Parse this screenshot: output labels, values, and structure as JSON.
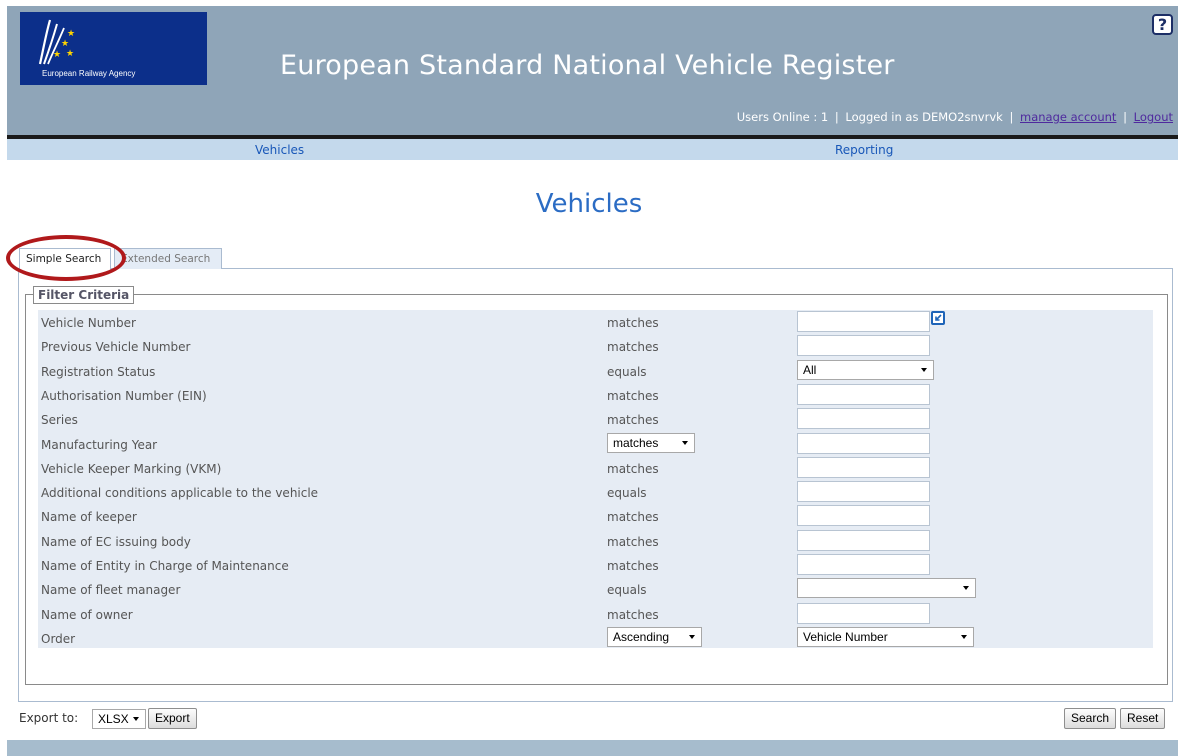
{
  "header": {
    "logo_text": "European Railway Agency",
    "app_title": "European Standard National Vehicle Register",
    "help_label": "?",
    "users_online": "Users Online : 1",
    "logged_in_as": "Logged in as DEMO2snvrvk",
    "manage_account": "manage account",
    "logout": "Logout",
    "separator": "|"
  },
  "nav": {
    "vehicles": "Vehicles",
    "reporting": "Reporting"
  },
  "page": {
    "title": "Vehicles",
    "tabs": [
      {
        "label": "Simple Search",
        "active": true
      },
      {
        "label": "Extended Search",
        "active": false
      }
    ]
  },
  "filter": {
    "legend": "Filter Criteria",
    "rows": [
      {
        "label": "Vehicle Number",
        "operator": "matches"
      },
      {
        "label": "Previous Vehicle Number",
        "operator": "matches"
      },
      {
        "label": "Registration Status",
        "operator": "equals",
        "value": "All"
      },
      {
        "label": "Authorisation Number (EIN)",
        "operator": "matches"
      },
      {
        "label": "Series",
        "operator": "matches"
      },
      {
        "label": "Manufacturing Year",
        "operator": "matches"
      },
      {
        "label": "Vehicle Keeper Marking (VKM)",
        "operator": "matches"
      },
      {
        "label": "Additional conditions applicable to the vehicle",
        "operator": "equals"
      },
      {
        "label": "Name of keeper",
        "operator": "matches"
      },
      {
        "label": "Name of EC issuing body",
        "operator": "matches"
      },
      {
        "label": "Name of Entity in Charge of Maintenance",
        "operator": "matches"
      },
      {
        "label": "Name of fleet manager",
        "operator": "equals",
        "value": ""
      },
      {
        "label": "Name of owner",
        "operator": "matches"
      },
      {
        "label": "Order",
        "operator": "Ascending",
        "value": "Vehicle Number"
      }
    ]
  },
  "footer": {
    "export_label": "Export to:",
    "export_format": "XLSX",
    "export_button": "Export",
    "search_button": "Search",
    "reset_button": "Reset"
  },
  "colors": {
    "header_bg": "#8fa5b8",
    "nav_bg": "#c4d9ec",
    "link": "#1857b8",
    "title": "#2b6cc4",
    "filter_bg": "#e6ecf4",
    "highlight_ring": "#b0191b"
  }
}
